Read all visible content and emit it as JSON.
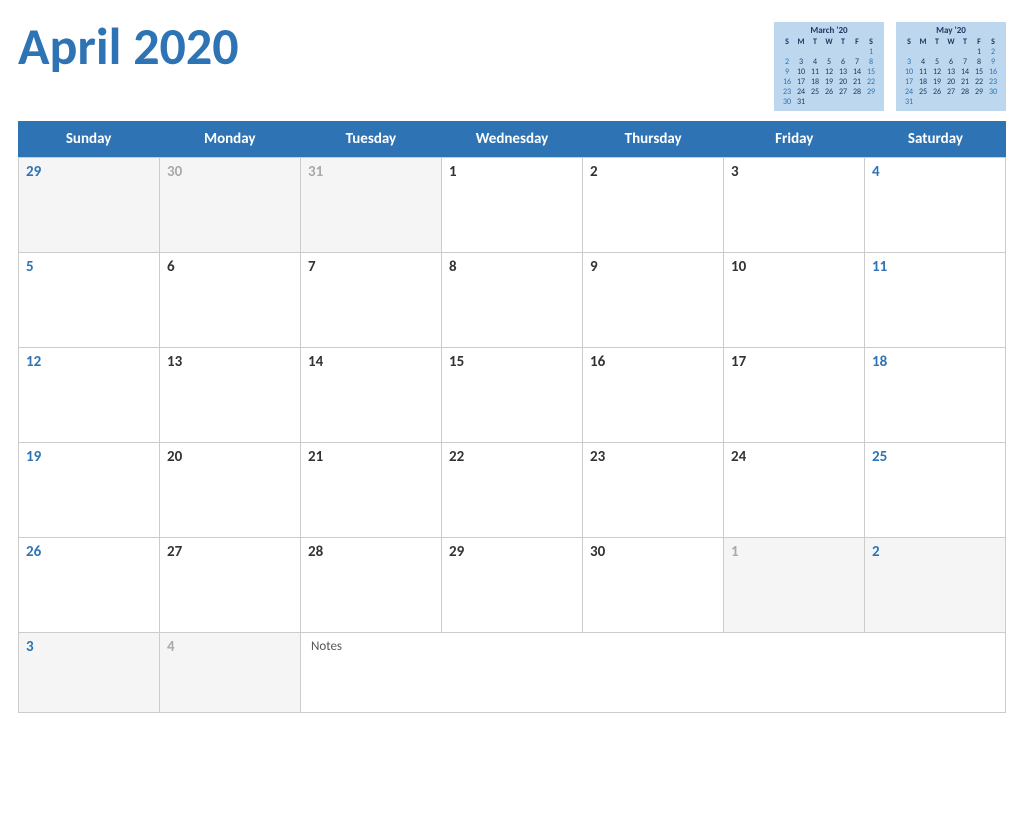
{
  "header": {
    "title": "April 2020"
  },
  "miniCals": [
    {
      "id": "march",
      "title": "March '20",
      "headers": [
        "S",
        "M",
        "T",
        "W",
        "T",
        "F",
        "S"
      ],
      "weeks": [
        [
          null,
          null,
          null,
          null,
          null,
          null,
          "1"
        ],
        [
          "2",
          "3",
          "4",
          "5",
          "6",
          "7",
          "8"
        ],
        [
          "9",
          "10",
          "11",
          "12",
          "13",
          "14",
          "15"
        ],
        [
          "16",
          "17",
          "18",
          "19",
          "20",
          "21",
          "22"
        ],
        [
          "23",
          "24",
          "25",
          "26",
          "27",
          "28",
          "29"
        ],
        [
          "30",
          "31",
          null,
          null,
          null,
          null,
          null
        ]
      ]
    },
    {
      "id": "may",
      "title": "May '20",
      "headers": [
        "S",
        "M",
        "T",
        "W",
        "T",
        "F",
        "S"
      ],
      "weeks": [
        [
          null,
          null,
          null,
          null,
          null,
          "1",
          "2"
        ],
        [
          "3",
          "4",
          "5",
          "6",
          "7",
          "8",
          "9"
        ],
        [
          "10",
          "11",
          "12",
          "13",
          "14",
          "15",
          "16"
        ],
        [
          "17",
          "18",
          "19",
          "20",
          "21",
          "22",
          "23"
        ],
        [
          "24",
          "25",
          "26",
          "27",
          "28",
          "29",
          "30"
        ],
        [
          "31",
          null,
          null,
          null,
          null,
          null,
          null
        ]
      ]
    }
  ],
  "weekdays": [
    "Sunday",
    "Monday",
    "Tuesday",
    "Wednesday",
    "Thursday",
    "Friday",
    "Saturday"
  ],
  "weeks": [
    {
      "days": [
        {
          "num": "29",
          "inMonth": false,
          "weekend": true
        },
        {
          "num": "30",
          "inMonth": false,
          "weekend": false
        },
        {
          "num": "31",
          "inMonth": false,
          "weekend": false
        },
        {
          "num": "1",
          "inMonth": true,
          "weekend": false
        },
        {
          "num": "2",
          "inMonth": true,
          "weekend": false
        },
        {
          "num": "3",
          "inMonth": true,
          "weekend": false
        },
        {
          "num": "4",
          "inMonth": true,
          "weekend": true
        }
      ]
    },
    {
      "days": [
        {
          "num": "5",
          "inMonth": true,
          "weekend": true
        },
        {
          "num": "6",
          "inMonth": true,
          "weekend": false
        },
        {
          "num": "7",
          "inMonth": true,
          "weekend": false
        },
        {
          "num": "8",
          "inMonth": true,
          "weekend": false
        },
        {
          "num": "9",
          "inMonth": true,
          "weekend": false
        },
        {
          "num": "10",
          "inMonth": true,
          "weekend": false
        },
        {
          "num": "11",
          "inMonth": true,
          "weekend": true
        }
      ]
    },
    {
      "days": [
        {
          "num": "12",
          "inMonth": true,
          "weekend": true
        },
        {
          "num": "13",
          "inMonth": true,
          "weekend": false
        },
        {
          "num": "14",
          "inMonth": true,
          "weekend": false
        },
        {
          "num": "15",
          "inMonth": true,
          "weekend": false
        },
        {
          "num": "16",
          "inMonth": true,
          "weekend": false
        },
        {
          "num": "17",
          "inMonth": true,
          "weekend": false
        },
        {
          "num": "18",
          "inMonth": true,
          "weekend": true
        }
      ]
    },
    {
      "days": [
        {
          "num": "19",
          "inMonth": true,
          "weekend": true
        },
        {
          "num": "20",
          "inMonth": true,
          "weekend": false
        },
        {
          "num": "21",
          "inMonth": true,
          "weekend": false
        },
        {
          "num": "22",
          "inMonth": true,
          "weekend": false
        },
        {
          "num": "23",
          "inMonth": true,
          "weekend": false
        },
        {
          "num": "24",
          "inMonth": true,
          "weekend": false
        },
        {
          "num": "25",
          "inMonth": true,
          "weekend": true
        }
      ]
    },
    {
      "days": [
        {
          "num": "26",
          "inMonth": true,
          "weekend": true
        },
        {
          "num": "27",
          "inMonth": true,
          "weekend": false
        },
        {
          "num": "28",
          "inMonth": true,
          "weekend": false
        },
        {
          "num": "29",
          "inMonth": true,
          "weekend": false
        },
        {
          "num": "30",
          "inMonth": true,
          "weekend": false
        },
        {
          "num": "1",
          "inMonth": false,
          "weekend": false
        },
        {
          "num": "2",
          "inMonth": false,
          "weekend": true
        }
      ]
    }
  ],
  "notesRow": {
    "days": [
      {
        "num": "3",
        "inMonth": false,
        "weekend": true
      },
      {
        "num": "4",
        "inMonth": false,
        "weekend": false
      }
    ],
    "notesLabel": "Notes"
  }
}
